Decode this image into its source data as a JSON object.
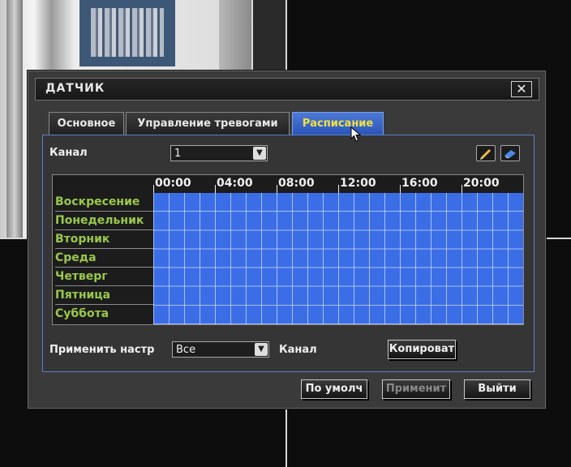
{
  "dialog": {
    "title": "ДАТЧИК",
    "close_icon": "close-icon"
  },
  "tabs": [
    {
      "label": "Основное",
      "active": false
    },
    {
      "label": "Управление тревогами",
      "active": false
    },
    {
      "label": "Расписание",
      "active": true
    }
  ],
  "channel": {
    "label": "Канал",
    "value": "1"
  },
  "tools": {
    "edit_icon": "pencil-icon",
    "erase_icon": "eraser-icon"
  },
  "schedule": {
    "hours": [
      "00:00",
      "04:00",
      "08:00",
      "12:00",
      "16:00",
      "20:00"
    ],
    "days": [
      "Воскресение",
      "Понедельник",
      "Вторник",
      "Среда",
      "Четверг",
      "Пятница",
      "Суббота"
    ],
    "fill_color": "#3b6ee6"
  },
  "apply_to": {
    "label": "Применить настр",
    "value": "Все",
    "suffix": "Канал",
    "copy_label": "Копироват"
  },
  "footer": {
    "default_label": "По умолч",
    "apply_label": "Применит",
    "exit_label": "Выйти"
  }
}
